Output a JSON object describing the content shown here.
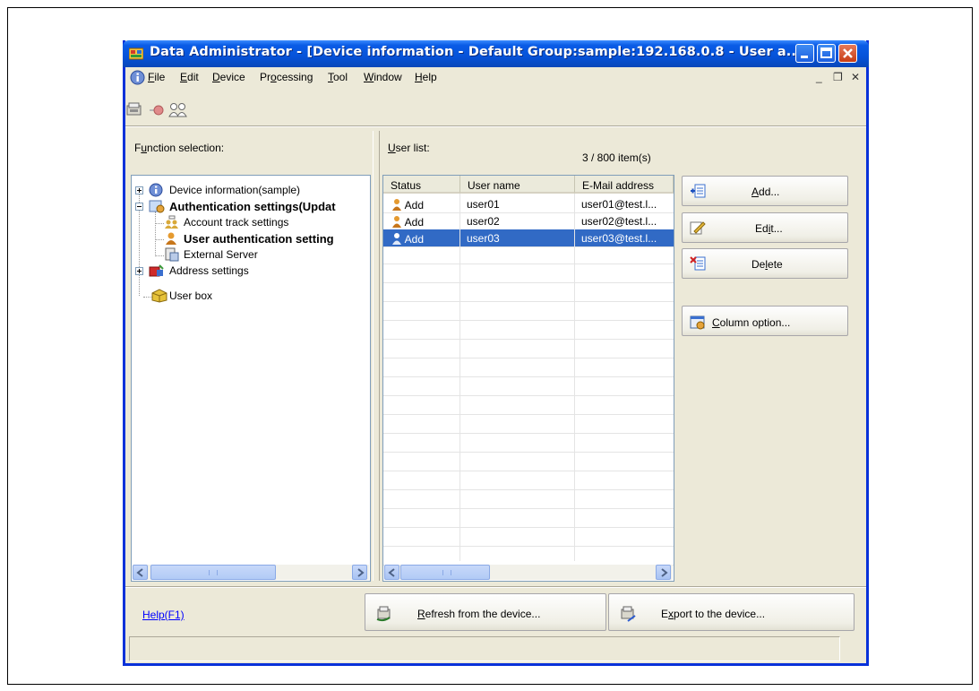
{
  "window": {
    "title": "Data Administrator - [Device information - Default Group:sample:192.168.0.8 - User a...",
    "colors": {
      "titlebar": "#0653d9",
      "selection": "#316ac5",
      "link": "#0000ff"
    }
  },
  "menu": {
    "items": [
      {
        "label": "File",
        "key": "F",
        "rest": "ile"
      },
      {
        "label": "Edit",
        "key": "E",
        "rest": "dit"
      },
      {
        "label": "Device",
        "key": "D",
        "rest": "evice"
      },
      {
        "label": "Processing",
        "pre": "Pr",
        "key": "o",
        "rest": "cessing"
      },
      {
        "label": "Tool",
        "key": "T",
        "rest": "ool"
      },
      {
        "label": "Window",
        "key": "W",
        "rest": "indow"
      },
      {
        "label": "Help",
        "key": "H",
        "rest": "elp"
      }
    ],
    "mdi_controls": [
      "_",
      "❐",
      "✕"
    ]
  },
  "toolbar": {
    "icons": [
      "device-icon",
      "connect-icon",
      "users-icon"
    ]
  },
  "function_panel": {
    "header_pre": "F",
    "header_key": "u",
    "header_rest": "nction selection:",
    "tree": [
      {
        "label": "Device information(sample)",
        "bold": false,
        "icon": "info-icon"
      },
      {
        "label": "Authentication settings(Updat",
        "bold": true,
        "icon": "auth-settings-icon"
      },
      {
        "label": "Account track settings",
        "bold": false,
        "icon": "account-track-icon"
      },
      {
        "label": "User authentication setting",
        "bold": true,
        "icon": "user-icon"
      },
      {
        "label": "External Server",
        "bold": false,
        "icon": "server-icon"
      },
      {
        "label": "Address settings",
        "bold": false,
        "icon": "address-icon"
      },
      {
        "label": "User box",
        "bold": false,
        "icon": "box-icon"
      }
    ]
  },
  "user_list": {
    "header_key": "U",
    "header_rest": "ser list:",
    "count": "3 / 800 item(s)",
    "columns": [
      "Status",
      "User name",
      "E-Mail address"
    ],
    "rows": [
      {
        "status": "Add",
        "user": "user01",
        "email": "user01@test.l..."
      },
      {
        "status": "Add",
        "user": "user02",
        "email": "user02@test.l..."
      },
      {
        "status": "Add",
        "user": "user03",
        "email": "user03@test.l..."
      }
    ],
    "selected_row": 2
  },
  "actions": {
    "add": {
      "key": "A",
      "rest": "dd...",
      "icon": "add-icon"
    },
    "edit": {
      "pre": "Ed",
      "key": "i",
      "rest": "t...",
      "icon": "edit-icon"
    },
    "delete": {
      "pre": "De",
      "key": "l",
      "rest": "ete",
      "icon": "delete-icon"
    },
    "column_option": {
      "key": "C",
      "rest": "olumn option...",
      "icon": "column-option-icon"
    }
  },
  "footer": {
    "help": "Help(F1)",
    "refresh": {
      "key": "R",
      "rest": "efresh from the device...",
      "icon": "refresh-icon"
    },
    "export": {
      "pre": "E",
      "key": "x",
      "rest": "port to the device...",
      "icon": "export-icon"
    },
    "status_text": ""
  }
}
